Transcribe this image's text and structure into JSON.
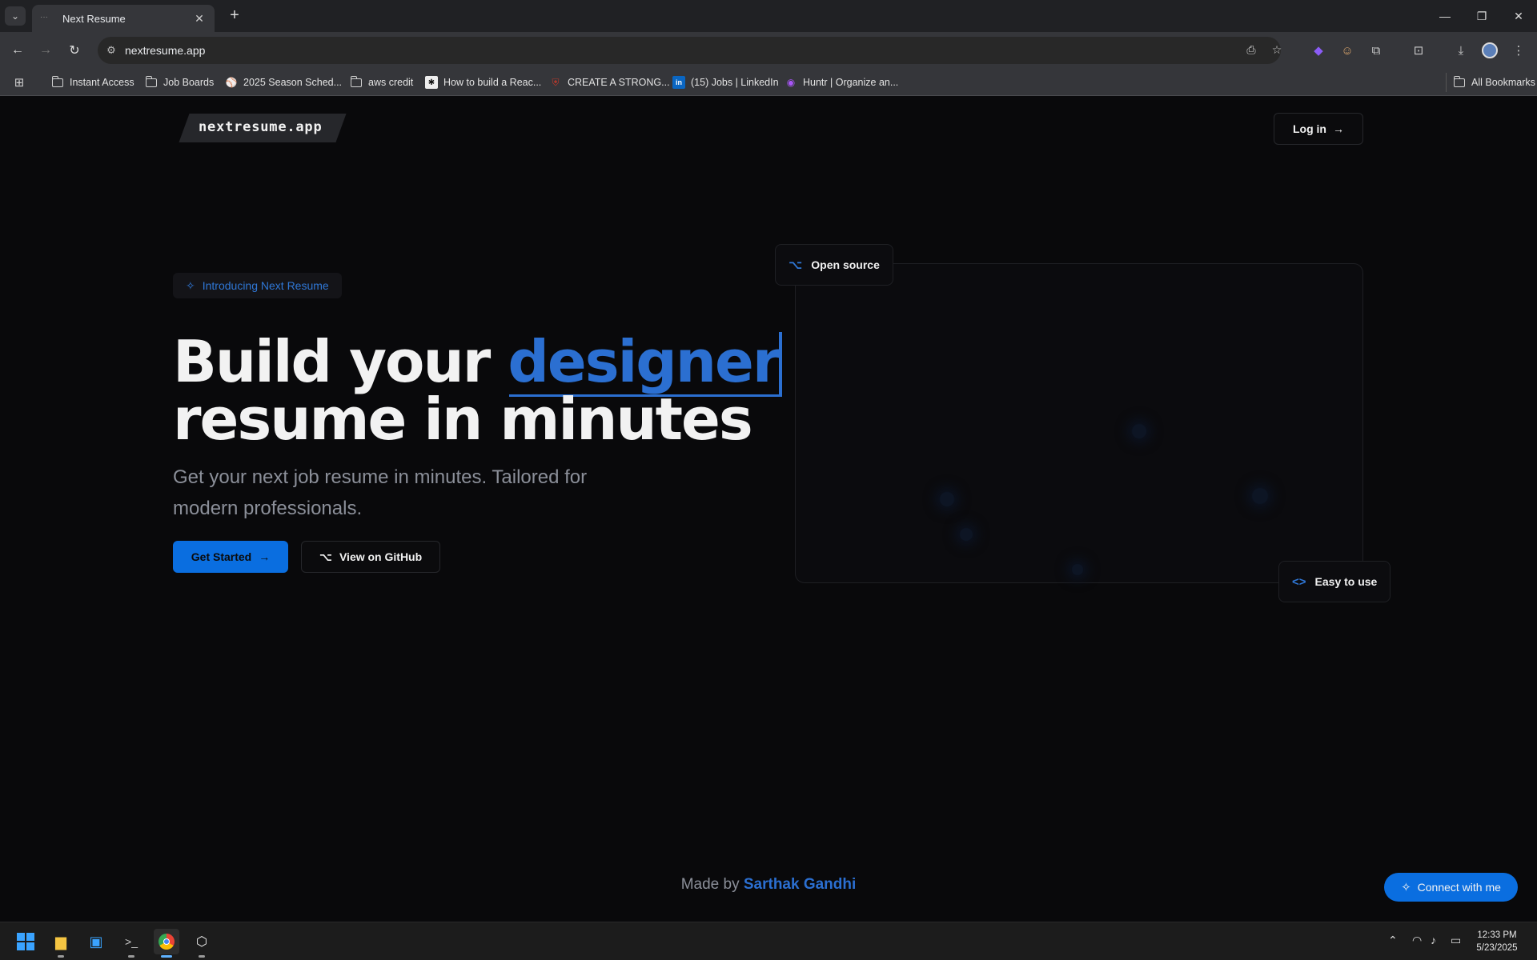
{
  "browser": {
    "tab_title": "Next Resume",
    "url": "nextresume.app",
    "bookmarks": [
      {
        "label": "Instant Access",
        "icon": "folder-icon"
      },
      {
        "label": "Job Boards",
        "icon": "folder-icon"
      },
      {
        "label": "2025 Season Sched...",
        "icon": "bat-icon"
      },
      {
        "label": "aws credit",
        "icon": "folder-icon"
      },
      {
        "label": "How to build a Reac...",
        "icon": "site-icon"
      },
      {
        "label": "CREATE A STRONG...",
        "icon": "shield-icon"
      },
      {
        "label": "(15) Jobs | LinkedIn",
        "icon": "linkedin-icon"
      },
      {
        "label": "Huntr | Organize an...",
        "icon": "huntr-icon"
      }
    ],
    "all_bookmarks": "All Bookmarks"
  },
  "page": {
    "logo": "nextresume.app",
    "login_label": "Log in",
    "pill_label": "Introducing Next Resume",
    "headline_line1_prefix": "Build your ",
    "headline_highlight": "designer",
    "headline_line2": "resume in minutes",
    "subtitle": "Get your next job resume in minutes. Tailored for modern professionals.",
    "get_started_label": "Get Started",
    "github_label": "View on GitHub",
    "open_source_label": "Open source",
    "easy_to_use_label": "Easy to use",
    "footer_prefix": "Made by ",
    "footer_author": "Sarthak Gandhi",
    "connect_label": "Connect with me",
    "accent_color": "#0a6ee0"
  },
  "taskbar": {
    "time": "12:33 PM",
    "date": "5/23/2025"
  }
}
